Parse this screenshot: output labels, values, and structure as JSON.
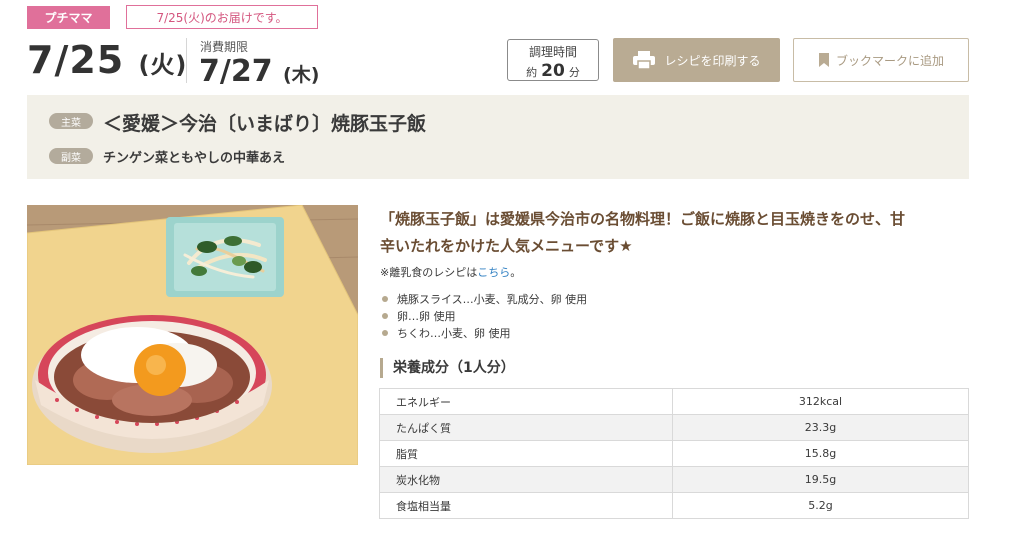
{
  "header": {
    "brand_tag": "プチママ",
    "delivery_notice": "7/25(火)のお届けです。",
    "date": "7/25",
    "date_dow": "(火)",
    "expiry_label": "消費期限",
    "expiry_date": "7/27",
    "expiry_dow": "(木)"
  },
  "cook_time": {
    "label": "調理時間",
    "prefix": "約",
    "value": "20",
    "unit": "分"
  },
  "actions": {
    "print_label": "レシピを印刷する",
    "bookmark_label": "ブックマークに追加"
  },
  "menu": {
    "main_tag": "主菜",
    "main_title": "＜愛媛＞今治〔いまばり〕焼豚玉子飯",
    "side_tag": "副菜",
    "side_title": "チンゲン菜ともやしの中華あえ"
  },
  "description": {
    "line1": "「焼豚玉子飯」は愛媛県今治市の名物料理！ご飯に焼豚と目玉焼きをのせ、甘",
    "line2": "辛いたれをかけた人気メニューです★",
    "baby_prefix": "※離乳食のレシピは",
    "baby_link": "こちら",
    "baby_suffix": "。"
  },
  "allergens": [
    "焼豚スライス…小麦、乳成分、卵 使用",
    "卵…卵 使用",
    "ちくわ…小麦、卵 使用"
  ],
  "nutrition": {
    "heading": "栄養成分（1人分）",
    "rows": [
      {
        "name": "エネルギー",
        "value": "312kcal"
      },
      {
        "name": "たんぱく質",
        "value": "23.3g"
      },
      {
        "name": "脂質",
        "value": "15.8g"
      },
      {
        "name": "炭水化物",
        "value": "19.5g"
      },
      {
        "name": "食塩相当量",
        "value": "5.2g"
      }
    ]
  },
  "colors": {
    "brand_pink": "#e0709a",
    "accent_beige": "#b9ab93",
    "desc_brown": "#6a4d33"
  },
  "icons": {
    "print": "printer-icon",
    "bookmark": "bookmark-icon"
  }
}
